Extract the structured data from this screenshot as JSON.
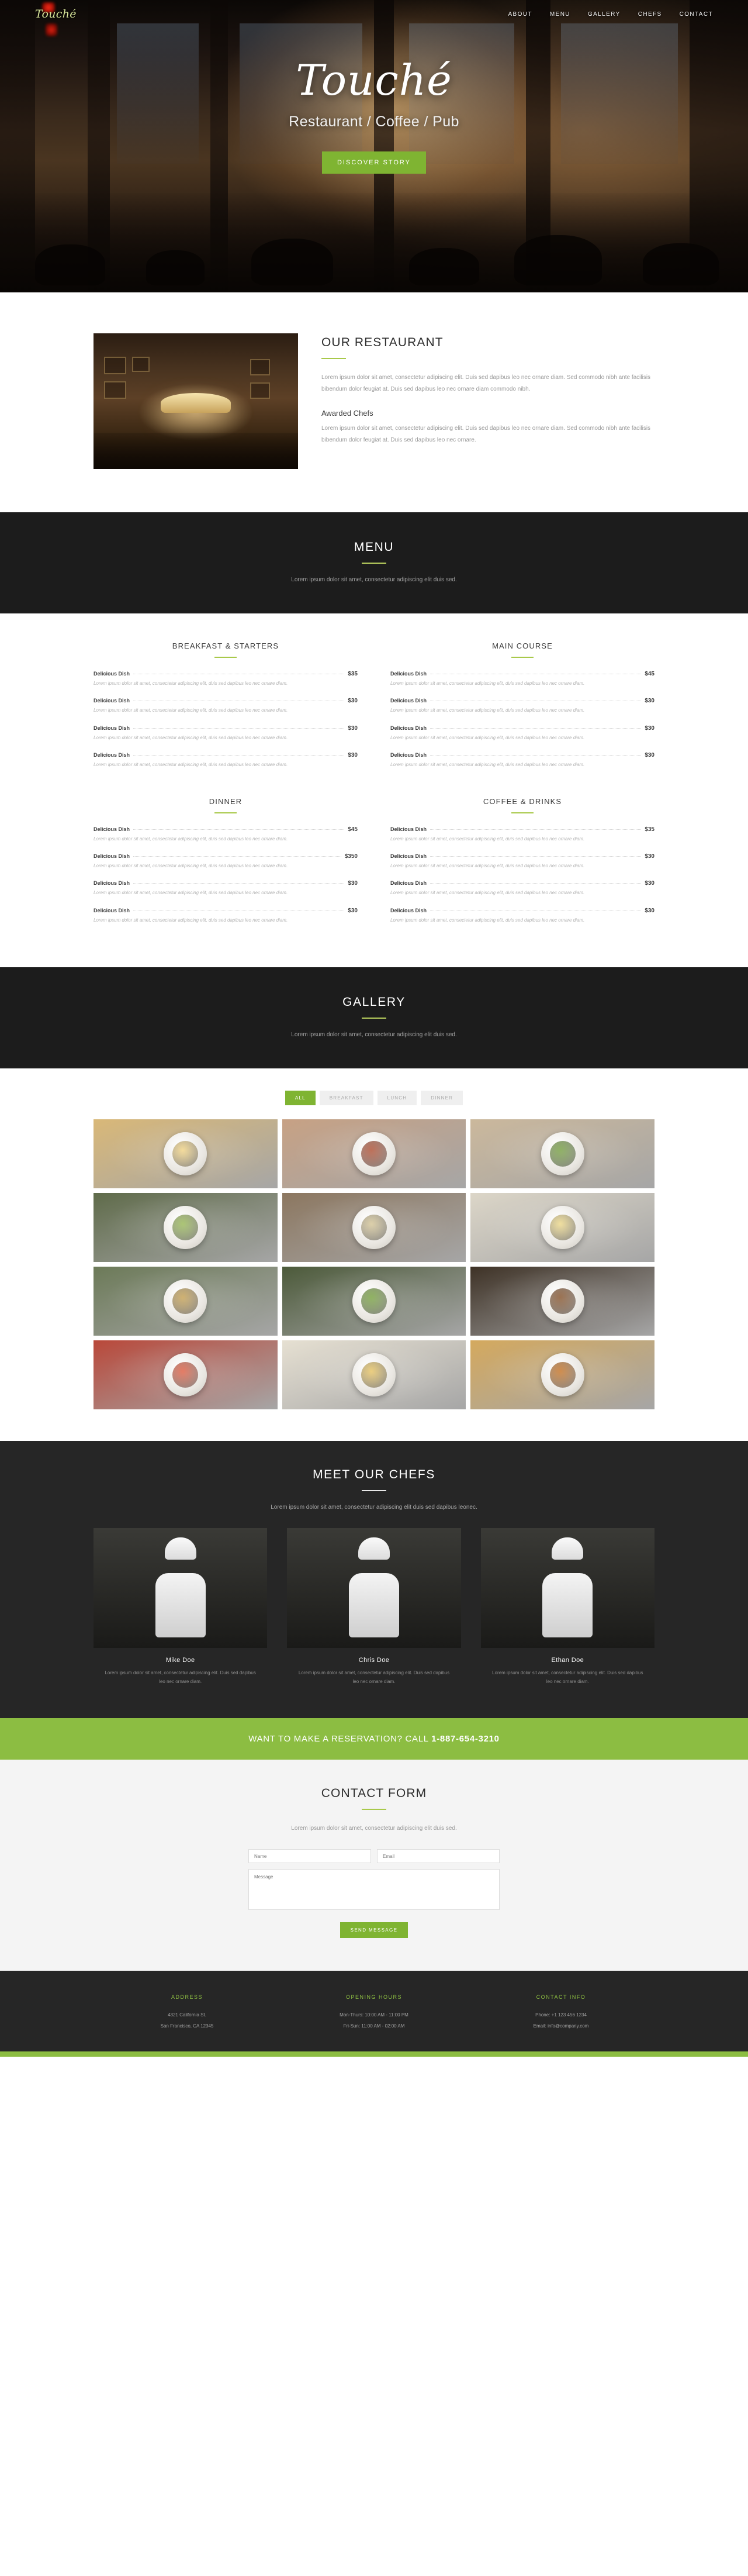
{
  "brand": "Touché",
  "nav": [
    {
      "label": "ABOUT"
    },
    {
      "label": "MENU"
    },
    {
      "label": "GALLERY"
    },
    {
      "label": "CHEFS"
    },
    {
      "label": "CONTACT"
    }
  ],
  "hero": {
    "title": "Touché",
    "subtitle": "Restaurant / Coffee / Pub",
    "cta": "DISCOVER STORY"
  },
  "about": {
    "title": "OUR RESTAURANT",
    "paragraph": "Lorem ipsum dolor sit amet, consectetur adipiscing elit. Duis sed dapibus leo nec ornare diam. Sed commodo nibh ante facilisis bibendum dolor feugiat at. Duis sed dapibus leo nec ornare diam commodo nibh.",
    "sub_title": "Awarded Chefs",
    "sub_paragraph": "Lorem ipsum dolor sit amet, consectetur adipiscing elit. Duis sed dapibus leo nec ornare diam. Sed commodo nibh ante facilisis bibendum dolor feugiat at. Duis sed dapibus leo nec ornare."
  },
  "menu": {
    "title": "MENU",
    "subtitle": "Lorem ipsum dolor sit amet, consectetur adipiscing elit duis sed.",
    "item_name": "Delicious Dish",
    "item_desc": "Lorem ipsum dolor sit amet, consectetur adipiscing elit, duis sed dapibus leo nec ornare diam.",
    "categories": [
      {
        "title": "BREAKFAST & STARTERS",
        "prices": [
          "$35",
          "$30",
          "$30",
          "$30"
        ]
      },
      {
        "title": "MAIN COURSE",
        "prices": [
          "$45",
          "$30",
          "$30",
          "$30"
        ]
      },
      {
        "title": "DINNER",
        "prices": [
          "$45",
          "$350",
          "$30",
          "$30"
        ]
      },
      {
        "title": "COFFEE & DRINKS",
        "prices": [
          "$35",
          "$30",
          "$30",
          "$30"
        ]
      }
    ]
  },
  "gallery": {
    "title": "GALLERY",
    "subtitle": "Lorem ipsum dolor sit amet, consectetur adipiscing elit duis sed.",
    "filters": [
      {
        "label": "ALL",
        "active": true
      },
      {
        "label": "BREAKFAST",
        "active": false
      },
      {
        "label": "LUNCH",
        "active": false
      },
      {
        "label": "DINNER",
        "active": false
      }
    ],
    "items": [
      {
        "caption": "gallery-image-1",
        "bg": "#d9b878",
        "food": "#f2d58a"
      },
      {
        "caption": "gallery-image-2",
        "bg": "#c7a184",
        "food": "#b2573c"
      },
      {
        "caption": "gallery-image-3",
        "bg": "#cbb89c",
        "food": "#7ca34a"
      },
      {
        "caption": "gallery-image-4",
        "bg": "#5f6b4a",
        "food": "#9dbb5e"
      },
      {
        "caption": "gallery-image-5",
        "bg": "#8c7760",
        "food": "#d6c79b"
      },
      {
        "caption": "gallery-image-6",
        "bg": "#dcd6c8",
        "food": "#edd98e"
      },
      {
        "caption": "gallery-image-7",
        "bg": "#6c7a58",
        "food": "#c7a45a"
      },
      {
        "caption": "gallery-image-8",
        "bg": "#4c5a3a",
        "food": "#7da548"
      },
      {
        "caption": "gallery-image-9",
        "bg": "#3e3226",
        "food": "#8a5a34"
      },
      {
        "caption": "gallery-image-10",
        "bg": "#b9483a",
        "food": "#e0654a"
      },
      {
        "caption": "gallery-image-11",
        "bg": "#e6e0d2",
        "food": "#e8c66a"
      },
      {
        "caption": "gallery-image-12",
        "bg": "#d4a95e",
        "food": "#c7792f"
      }
    ]
  },
  "chefs": {
    "title": "MEET OUR CHEFS",
    "subtitle": "Lorem ipsum dolor sit amet, consectetur adipiscing elit duis sed dapibus leonec.",
    "desc": "Lorem ipsum dolor sit amet, consectetur adipiscing elit. Duis sed dapibus leo nec ornare diam.",
    "people": [
      {
        "name": "Mike Doe"
      },
      {
        "name": "Chris Doe"
      },
      {
        "name": "Ethan Doe"
      }
    ]
  },
  "reservation": {
    "text": "WANT TO MAKE A RESERVATION? CALL",
    "phone": "1-887-654-3210"
  },
  "contact": {
    "title": "CONTACT FORM",
    "subtitle": "Lorem ipsum dolor sit amet, consectetur adipiscing elit duis sed.",
    "name_placeholder": "Name",
    "email_placeholder": "Email",
    "message_placeholder": "Message",
    "send_label": "SEND MESSAGE"
  },
  "footer": {
    "columns": [
      {
        "heading": "ADDRESS",
        "lines": [
          "4321 California St.",
          "San Francisco, CA 12345"
        ]
      },
      {
        "heading": "OPENING HOURS",
        "lines": [
          "Mon-Thurs: 10:00 AM - 11:00 PM",
          "Fri-Sun: 11:00 AM - 02:00 AM"
        ]
      },
      {
        "heading": "CONTACT INFO",
        "lines": [
          "Phone: +1 123 456 1234",
          "Email: info@company.com"
        ]
      }
    ]
  },
  "colors": {
    "accent_green": "#8cbd42",
    "button_green": "#7fb432",
    "rule_green": "#a8c94a",
    "dark": "#1c1c1c",
    "chef_dark": "#262626"
  }
}
